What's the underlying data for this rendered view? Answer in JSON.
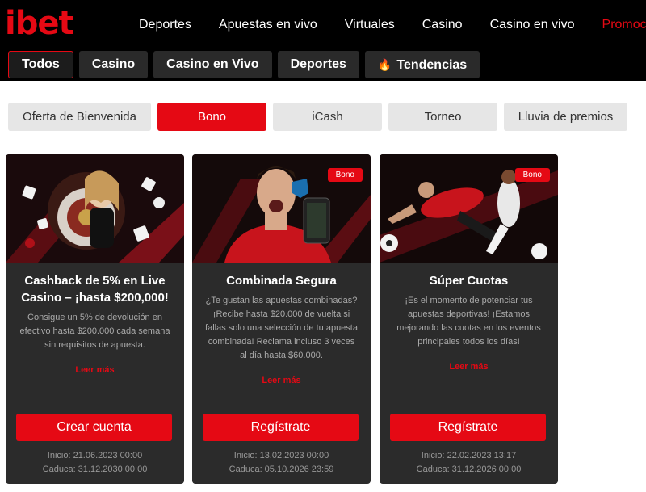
{
  "brand": {
    "logo": "ibet",
    "accent": "#e50914"
  },
  "main_nav": [
    {
      "label": "Deportes"
    },
    {
      "label": "Apuestas en vivo"
    },
    {
      "label": "Virtuales"
    },
    {
      "label": "Casino"
    },
    {
      "label": "Casino en vivo"
    },
    {
      "label": "Promociones",
      "active": true
    }
  ],
  "sub_nav": [
    {
      "label": "Todos",
      "active": true
    },
    {
      "label": "Casino"
    },
    {
      "label": "Casino en Vivo"
    },
    {
      "label": "Deportes"
    },
    {
      "label": "Tendencias",
      "icon": "flame-icon"
    }
  ],
  "filters": [
    {
      "label": "Oferta de Bienvenida"
    },
    {
      "label": "Bono",
      "active": true
    },
    {
      "label": "iCash"
    },
    {
      "label": "Torneo"
    },
    {
      "label": "Lluvia de premios"
    }
  ],
  "promos": [
    {
      "title": "Cashback de 5% en Live Casino – ¡hasta $200,000!",
      "description": "Consigue un 5% de devolución en efectivo hasta $200.000 cada semana sin requisitos de apuesta.",
      "read_more": "Leer más",
      "cta": "Crear cuenta",
      "start": "Inicio: 21.06.2023 00:00",
      "end": "Caduca: 31.12.2030 00:00"
    },
    {
      "badge": "Bono",
      "title": "Combinada Segura",
      "description": "¿Te gustan las apuestas combinadas? ¡Recibe hasta $20.000 de vuelta si fallas solo una selección de tu apuesta combinada! Reclama incluso 3 veces al día hasta $60.000.",
      "read_more": "Leer más",
      "cta": "Regístrate",
      "start": "Inicio: 13.02.2023 00:00",
      "end": "Caduca: 05.10.2026 23:59"
    },
    {
      "badge": "Bono",
      "title": "Súper Cuotas",
      "description": "¡Es el momento de potenciar tus apuestas deportivas! ¡Estamos mejorando las cuotas en los eventos principales todos los días!",
      "read_more": "Leer más",
      "cta": "Regístrate",
      "start": "Inicio: 22.02.2023 13:17",
      "end": "Caduca: 31.12.2026 00:00"
    }
  ]
}
